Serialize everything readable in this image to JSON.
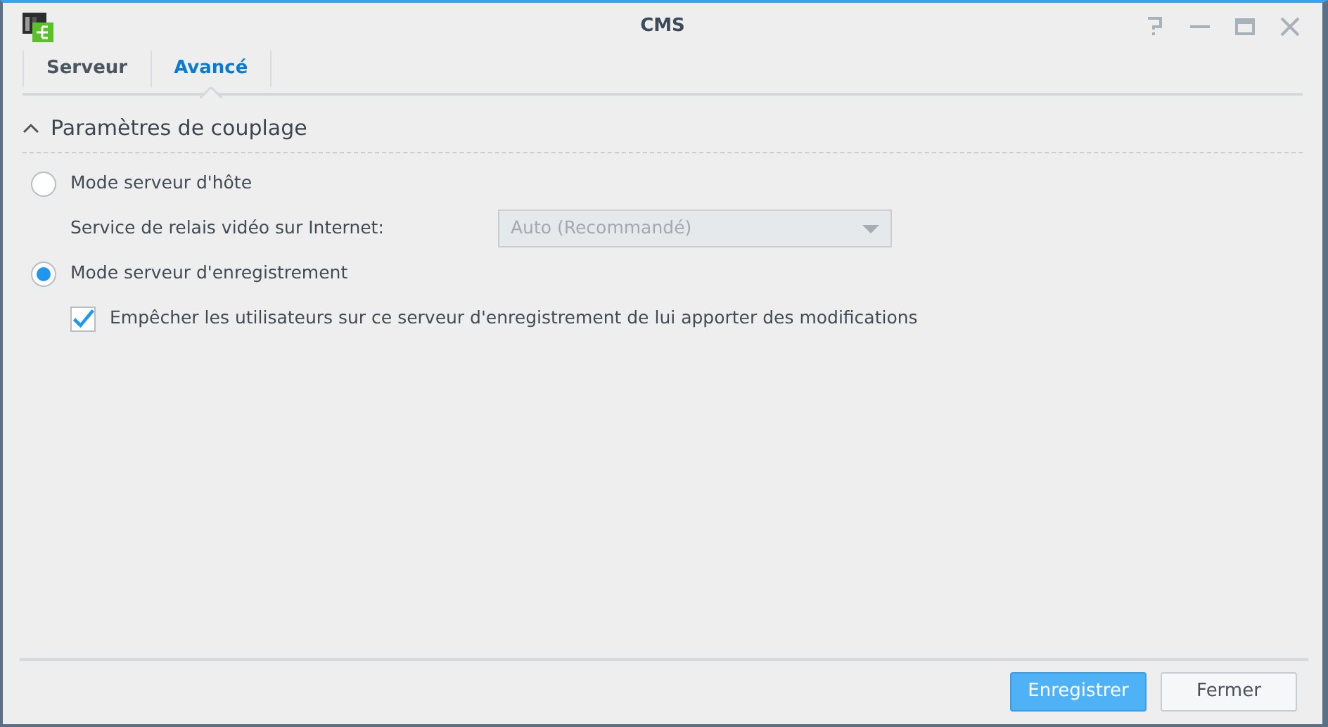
{
  "window": {
    "title": "CMS"
  },
  "tabs": [
    {
      "label": "Serveur",
      "selected": false
    },
    {
      "label": "Avancé",
      "selected": true
    }
  ],
  "section": {
    "title": "Paramètres de couplage",
    "expanded": true
  },
  "options": [
    {
      "kind": "radio",
      "label": "Mode serveur d'hôte",
      "selected": false
    },
    {
      "kind": "select",
      "label": "Service de relais vidéo sur Internet:",
      "value": "Auto (Recommandé)",
      "disabled": true
    },
    {
      "kind": "radio",
      "label": "Mode serveur d'enregistrement",
      "selected": true
    },
    {
      "kind": "checkbox",
      "label": "Empêcher les utilisateurs sur ce serveur d'enregistrement de lui apporter des modifications",
      "checked": true
    }
  ],
  "buttons": [
    {
      "label": "Enregistrer",
      "kind": "primary"
    },
    {
      "label": "Fermer",
      "kind": "default"
    }
  ]
}
